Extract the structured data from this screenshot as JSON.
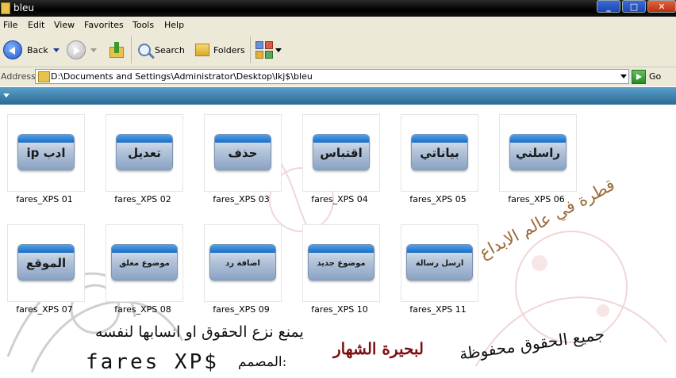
{
  "window": {
    "title": "bleu"
  },
  "menu": [
    "File",
    "Edit",
    "View",
    "Favorites",
    "Tools",
    "Help"
  ],
  "toolbar": {
    "back": "Back",
    "search": "Search",
    "folders": "Folders"
  },
  "address": {
    "label": "Address",
    "value": "D:\\Documents and Settings\\Administrator\\Desktop\\lkj$\\bleu",
    "go": "Go"
  },
  "files": [
    {
      "name": "fares_XPS 01",
      "thumb_text": "ip ادب"
    },
    {
      "name": "fares_XPS 02",
      "thumb_text": "تعديل"
    },
    {
      "name": "fares_XPS 03",
      "thumb_text": "حذف"
    },
    {
      "name": "fares_XPS 04",
      "thumb_text": "اقتباس"
    },
    {
      "name": "fares_XPS 05",
      "thumb_text": "بياناتي"
    },
    {
      "name": "fares_XPS 06",
      "thumb_text": "راسلني"
    },
    {
      "name": "fares_XPS 07",
      "thumb_text": "الموقع"
    },
    {
      "name": "fares_XPS 08",
      "thumb_text": "موضوع مغلق"
    },
    {
      "name": "fares_XPS 09",
      "thumb_text": "اضافة رد"
    },
    {
      "name": "fares_XPS 10",
      "thumb_text": "موضوع جديد"
    },
    {
      "name": "fares_XPS 11",
      "thumb_text": "ارسل رسالة"
    }
  ],
  "watermark": {
    "line1": "يمنع نزع الحقوق او انسابها لنفسه",
    "line2": "المصمم:",
    "author": "fares XP$",
    "rights": "جميع الحقوق محفوظة",
    "forum": "لبحيرة الشهار",
    "tagline": "قطرة في عالم الابداع"
  }
}
